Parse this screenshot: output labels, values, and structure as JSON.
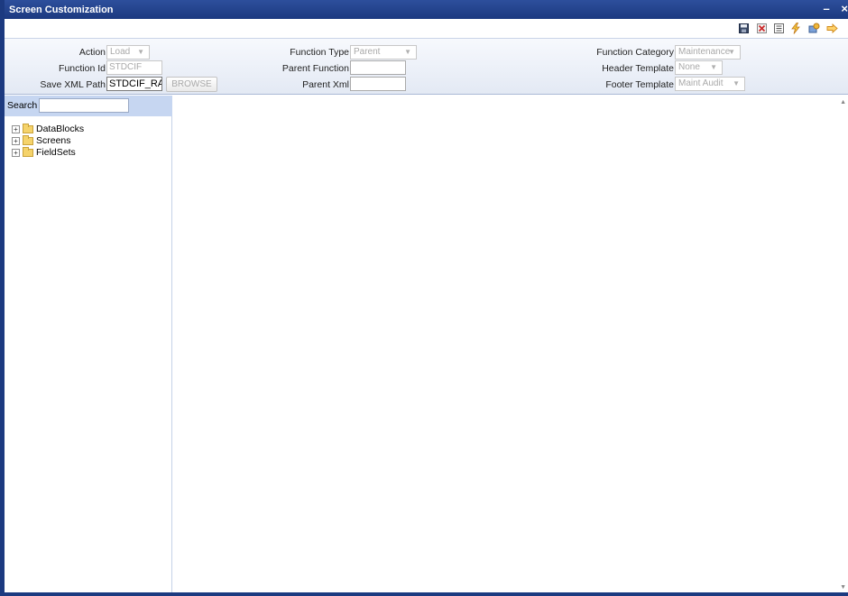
{
  "window": {
    "title": "Screen Customization",
    "minimize_glyph": "–",
    "close_glyph": "×"
  },
  "toolbar": {
    "icons": [
      "save-icon",
      "close-icon",
      "list-icon",
      "generate-icon",
      "release-icon",
      "exit-icon"
    ],
    "colors": {
      "close": "#cc2a2a",
      "generate": "#e6a020",
      "exit": "#e8a020"
    }
  },
  "form": {
    "action": {
      "label": "Action",
      "value": "Load"
    },
    "function_id": {
      "label": "Function Id",
      "value": "STDCIF"
    },
    "save_xml_path": {
      "label": "Save XML Path",
      "value": "STDCIF_RAD."
    },
    "browse_button": "BROWSE",
    "function_type": {
      "label": "Function Type",
      "value": "Parent"
    },
    "parent_function": {
      "label": "Parent Function",
      "value": ""
    },
    "parent_xml": {
      "label": "Parent Xml",
      "value": ""
    },
    "function_category": {
      "label": "Function Category",
      "value": "Maintenance"
    },
    "header_template": {
      "label": "Header Template",
      "value": "None"
    },
    "footer_template": {
      "label": "Footer Template",
      "value": "Maint Audit"
    }
  },
  "sidebar": {
    "search_label": "Search",
    "search_value": "",
    "tree": [
      {
        "label": "DataBlocks"
      },
      {
        "label": "Screens"
      },
      {
        "label": "FieldSets"
      }
    ]
  },
  "colors": {
    "title_bar": "#1c3a80",
    "search_bar": "#c6d6f1",
    "header_panel": "#e3e9f4"
  }
}
